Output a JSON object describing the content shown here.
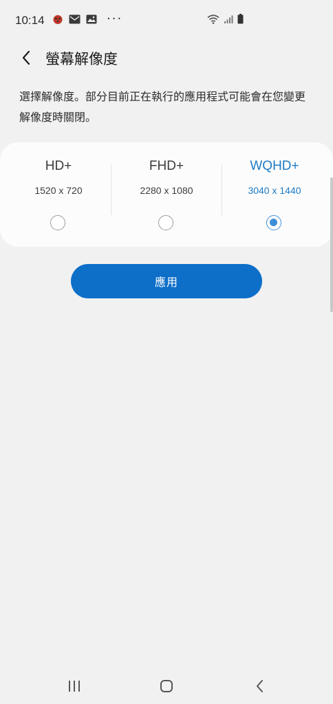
{
  "status_bar": {
    "time": "10:14",
    "more_indicator": "···",
    "left_icons": [
      "app-notification-icon",
      "mail-icon",
      "image-icon"
    ],
    "right_icons": [
      "wifi-icon",
      "signal-icon",
      "battery-icon"
    ]
  },
  "app_bar": {
    "title": "螢幕解像度",
    "back_icon": "chevron-left-icon"
  },
  "description": "選擇解像度。部分目前正在執行的應用程式可能會在您變更解像度時關閉。",
  "resolutions": [
    {
      "name": "HD+",
      "resolution": "1520 x 720",
      "selected": false
    },
    {
      "name": "FHD+",
      "resolution": "2280 x 1080",
      "selected": false
    },
    {
      "name": "WQHD+",
      "resolution": "3040 x 1440",
      "selected": true
    }
  ],
  "apply_button": {
    "label": "應用"
  },
  "colors": {
    "accent": "#1d7ac4",
    "button": "#0d6fc8",
    "background": "#f1f1f1",
    "card": "#fcfcfc"
  },
  "nav_bar": {
    "icons": [
      "recent-apps-icon",
      "home-icon",
      "back-icon"
    ]
  }
}
